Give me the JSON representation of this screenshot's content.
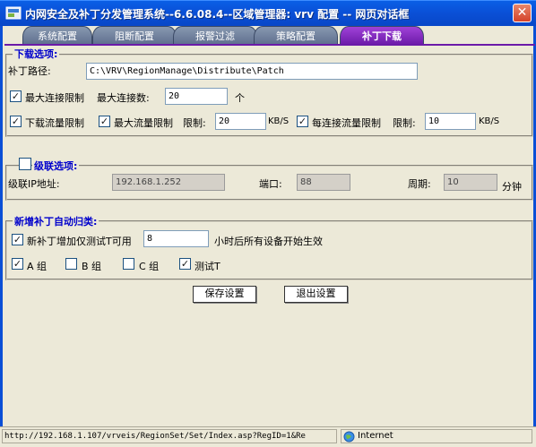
{
  "window": {
    "title": "内网安全及补丁分发管理系统--6.6.08.4--区域管理器: vrv 配置 -- 网页对话框",
    "close_symbol": "✕"
  },
  "tabs": [
    {
      "label": "系统配置",
      "active": false
    },
    {
      "label": "阻断配置",
      "active": false
    },
    {
      "label": "报警过滤",
      "active": false
    },
    {
      "label": "策略配置",
      "active": false
    },
    {
      "label": "补丁下载",
      "active": true
    }
  ],
  "download": {
    "legend": "下载选项:",
    "path_label": "补丁路径:",
    "path_value": "C:\\VRV\\RegionManage\\Distribute\\Patch",
    "max_conn_check": "最大连接限制",
    "max_conn_label": "最大连接数:",
    "max_conn_value": "20",
    "max_conn_unit": "个",
    "dl_flow_check": "下载流量限制",
    "max_flow_check": "最大流量限制",
    "max_flow_label": "限制:",
    "max_flow_value": "20",
    "max_flow_unit": "KB/S",
    "per_conn_check": "每连接流量限制",
    "per_conn_label": "限制:",
    "per_conn_value": "10",
    "per_conn_unit": "KB/S"
  },
  "cascade": {
    "legend": "级联选项:",
    "ip_label": "级联IP地址:",
    "ip_value": "192.168.1.252",
    "port_label": "端口:",
    "port_value": "88",
    "period_label": "周期:",
    "period_value": "10",
    "period_unit": "分钟"
  },
  "auto_class": {
    "legend": "新增补丁自动归类:",
    "test_check": "新补丁增加仅测试T可用",
    "hours_value": "8",
    "hours_suffix": "小时后所有设备开始生效",
    "group_a": "A 组",
    "group_b": "B 组",
    "group_c": "C 组",
    "group_t": "测试T"
  },
  "buttons": {
    "save": "保存设置",
    "exit": "退出设置"
  },
  "status": {
    "url": "http://192.168.1.107/vrveis/RegionSet/Set/Index.asp?RegID=1&Re",
    "zone": "Internet"
  },
  "colors": {
    "title_blue": "#0a4fd6",
    "tab_active": "#6b1aa8",
    "legend_blue": "#0000cc"
  }
}
